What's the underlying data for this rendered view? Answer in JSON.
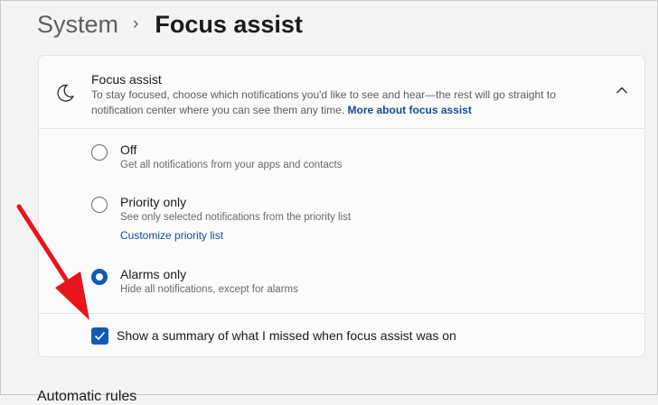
{
  "breadcrumb": {
    "parent": "System",
    "separator": "›",
    "current": "Focus assist"
  },
  "focus_assist": {
    "title": "Focus assist",
    "description": "To stay focused, choose which notifications you'd like to see and hear—the rest will go straight to notification center where you can see them any time.",
    "link": "More about focus assist",
    "icon": "moon-icon",
    "expanded": true
  },
  "options": [
    {
      "label": "Off",
      "desc": "Get all notifications from your apps and contacts",
      "selected": false
    },
    {
      "label": "Priority only",
      "desc": "See only selected notifications from the priority list",
      "link": "Customize priority list",
      "selected": false
    },
    {
      "label": "Alarms only",
      "desc": "Hide all notifications, except for alarms",
      "selected": true
    }
  ],
  "summary_checkbox": {
    "label": "Show a summary of what I missed when focus assist was on",
    "checked": true
  },
  "next_section_partial": "Automatic rules",
  "colors": {
    "accent": "#0f5cb2",
    "link": "#0f4f99",
    "annotation_arrow": "#e8141c"
  }
}
